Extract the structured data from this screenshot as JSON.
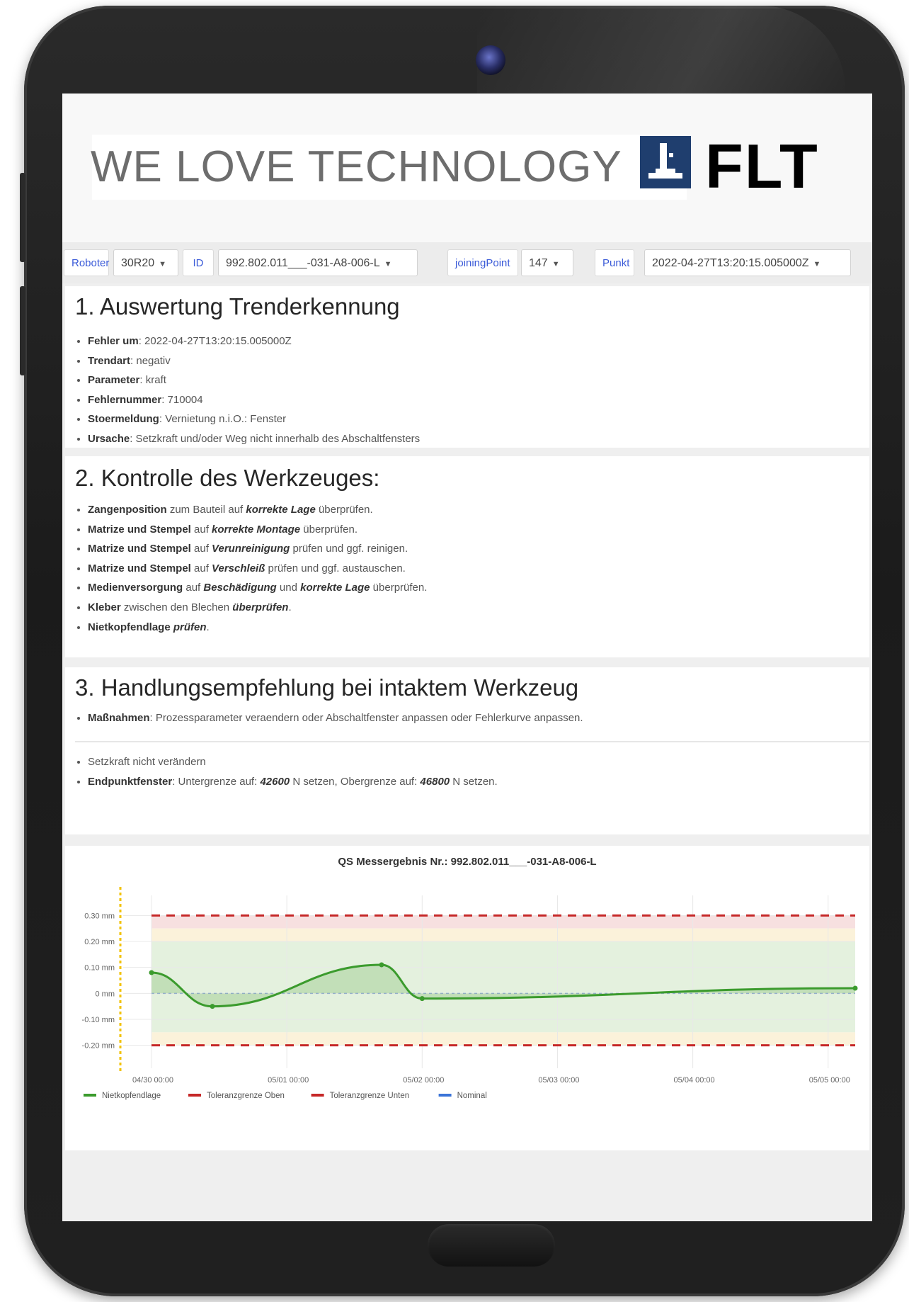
{
  "brand": {
    "slogan": "WE LOVE TECHNOLOGY",
    "logo_text": "FLT",
    "logo_color": "#1f3e6e"
  },
  "filters": [
    {
      "label": "Roboter",
      "value": "30R20"
    },
    {
      "label": "ID",
      "value": "992.802.011___-031-A8-006-L"
    },
    {
      "label": "joiningPoint",
      "value": "147"
    },
    {
      "label": "Punkt",
      "value": "2022-04-27T13:20:15.005000Z"
    }
  ],
  "section1": {
    "title": "1. Auswertung Trenderkennung",
    "items": [
      {
        "key": "Fehler um",
        "value": "2022-04-27T13:20:15.005000Z"
      },
      {
        "key": "Trendart",
        "value": "negativ"
      },
      {
        "key": "Parameter",
        "value": "kraft"
      },
      {
        "key": "Fehlernummer",
        "value": "710004"
      },
      {
        "key": "Stoermeldung",
        "value": "Vernietung n.i.O.: Fenster"
      },
      {
        "key": "Ursache",
        "value": "Setzkraft und/oder Weg nicht innerhalb des Abschaltfensters"
      }
    ]
  },
  "section2": {
    "title": "2. Kontrolle des Werkzeuges:",
    "items": [
      {
        "b1": "Zangenposition",
        "t1": " zum Bauteil auf ",
        "i1": "korrekte Lage",
        "t2": " überprüfen."
      },
      {
        "b1": "Matrize und Stempel",
        "t1": " auf ",
        "i1": "korrekte Montage",
        "t2": " überprüfen."
      },
      {
        "b1": "Matrize und Stempel",
        "t1": " auf ",
        "i1": "Verunreinigung",
        "t2": " prüfen und ggf. reinigen."
      },
      {
        "b1": "Matrize und Stempel",
        "t1": " auf ",
        "i1": "Verschleiß",
        "t2": " prüfen und ggf. austauschen."
      },
      {
        "b1": "Medienversorgung",
        "t1": " auf ",
        "i1": "Beschädigung",
        "t2": " und ",
        "i2": "korrekte Lage",
        "t3": " überprüfen."
      },
      {
        "b1": "Kleber",
        "t1": " zwischen den Blechen ",
        "i1": "überprüfen",
        "t2": "."
      },
      {
        "b1": "Nietkopfendlage",
        "t1": " ",
        "i1": "prüfen",
        "t2": "."
      }
    ]
  },
  "section3": {
    "title": "3. Handlungsempfehlung bei intaktem Werkzeug",
    "measure_key": "Maßnahmen",
    "measure_value": "Prozessparameter veraendern oder Abschaltfenster anpassen oder Fehlerkurve anpassen.",
    "item_force": "Setzkraft nicht verändern",
    "endpoint_key": "Endpunktfenster",
    "endpoint_t1": "Untergrenze auf: ",
    "endpoint_lower": "42600",
    "endpoint_t2": " N setzen, Obergrenze auf: ",
    "endpoint_upper": "46800",
    "endpoint_t3": " N setzen."
  },
  "chart_data": {
    "type": "line",
    "title": "QS Messergebnis Nr.: 992.802.011___-031-A8-006-L",
    "y_ticks": [
      "0.30 mm",
      "0.20 mm",
      "0.10 mm",
      "0 mm",
      "-0.10 mm",
      "-0.20 mm"
    ],
    "x_ticks": [
      "04/30 00:00",
      "05/01 00:00",
      "05/02 00:00",
      "05/03 00:00",
      "05/04 00:00",
      "05/05 00:00"
    ],
    "ylim": [
      -0.25,
      0.35
    ],
    "x_unit": "days since 04/30 00:00",
    "series": [
      {
        "name": "Nietkopfendlage",
        "color": "#3b9b2d",
        "x": [
          0.0,
          0.45,
          1.7,
          2.0,
          5.2
        ],
        "y": [
          0.08,
          -0.05,
          0.11,
          -0.02,
          0.02
        ]
      },
      {
        "name": "Toleranzgrenze Oben",
        "color": "#c62828",
        "x": [
          0.0,
          5.2
        ],
        "y": [
          0.3,
          0.3
        ]
      },
      {
        "name": "Toleranzgrenze Unten",
        "color": "#c62828",
        "x": [
          0.0,
          5.2
        ],
        "y": [
          -0.2,
          -0.2
        ]
      },
      {
        "name": "Nominal",
        "color": "#3b74d8",
        "x": [
          0.0,
          5.2
        ],
        "y": [
          0.0,
          0.0
        ]
      }
    ]
  }
}
